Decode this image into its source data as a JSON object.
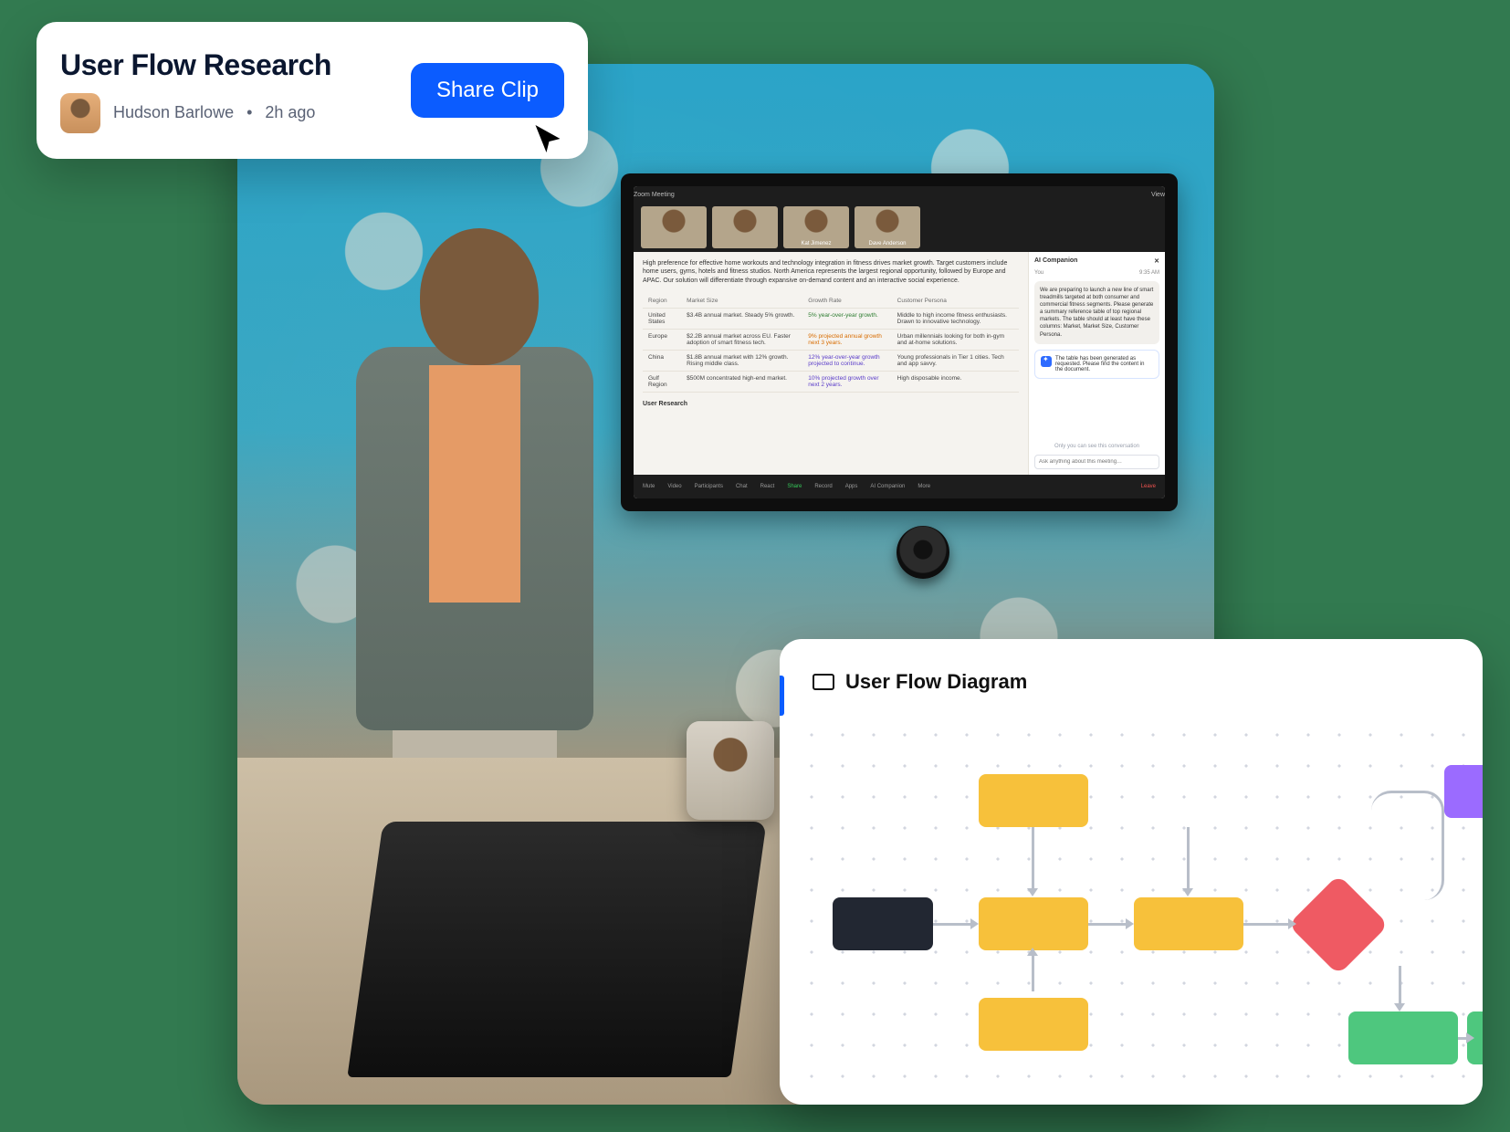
{
  "share_card": {
    "title": "User Flow Research",
    "author": "Hudson Barlowe",
    "time_sep": "•",
    "time": "2h ago",
    "button": "Share Clip"
  },
  "tv": {
    "window_title": "Zoom Meeting",
    "view_label": "View",
    "participants": [
      "",
      "",
      "Kat Jimenez",
      "Dave Anderson"
    ],
    "doc_paragraph": "High preference for effective home workouts and technology integration in fitness drives market growth. Target customers include home users, gyms, hotels and fitness studios. North America represents the largest regional opportunity, followed by Europe and APAC. Our solution will differentiate through expansive on-demand content and an interactive social experience.",
    "table": {
      "headers": [
        "Region",
        "Market Size",
        "Growth Rate",
        "Customer Persona"
      ],
      "rows": [
        {
          "region": "United States",
          "size": "$3.4B annual market. Steady 5% growth.",
          "growth": "5% year-over-year growth.",
          "growth_class": "growth-good",
          "persona": "Middle to high income fitness enthusiasts. Drawn to innovative technology."
        },
        {
          "region": "Europe",
          "size": "$2.2B annual market across EU. Faster adoption of smart fitness tech.",
          "growth": "9% projected annual growth next 3 years.",
          "growth_class": "growth-warn",
          "persona": "Urban millennials looking for both in-gym and at-home solutions."
        },
        {
          "region": "China",
          "size": "$1.8B annual market with 12% growth. Rising middle class.",
          "growth": "12% year-over-year growth projected to continue.",
          "growth_class": "growth-note",
          "persona": "Young professionals in Tier 1 cities. Tech and app savvy."
        },
        {
          "region": "Gulf Region",
          "size": "$500M concentrated high-end market.",
          "growth": "10% projected growth over next 2 years.",
          "growth_class": "growth-note",
          "persona": "High disposable income."
        }
      ]
    },
    "section_heading": "User Research",
    "ai_panel": {
      "title": "AI Companion",
      "sender": "You",
      "timestamp": "9:35 AM",
      "prompt": "We are preparing to launch a new line of smart treadmills targeted at both consumer and commercial fitness segments. Please generate a summary reference table of top regional markets.\n\nThe table should at least have these columns: Market, Market Size, Customer Persona.",
      "response": "The table has been generated as requested. Please find the content in the document.",
      "input_placeholder": "Ask anything about this meeting…",
      "footer_note": "Only you can see this conversation"
    },
    "toolbar": [
      "Mute",
      "Video",
      "Participants",
      "Chat",
      "React",
      "Share",
      "Record",
      "Apps",
      "AI Companion",
      "More",
      "Leave"
    ]
  },
  "flow_card": {
    "title": "User Flow Diagram"
  }
}
